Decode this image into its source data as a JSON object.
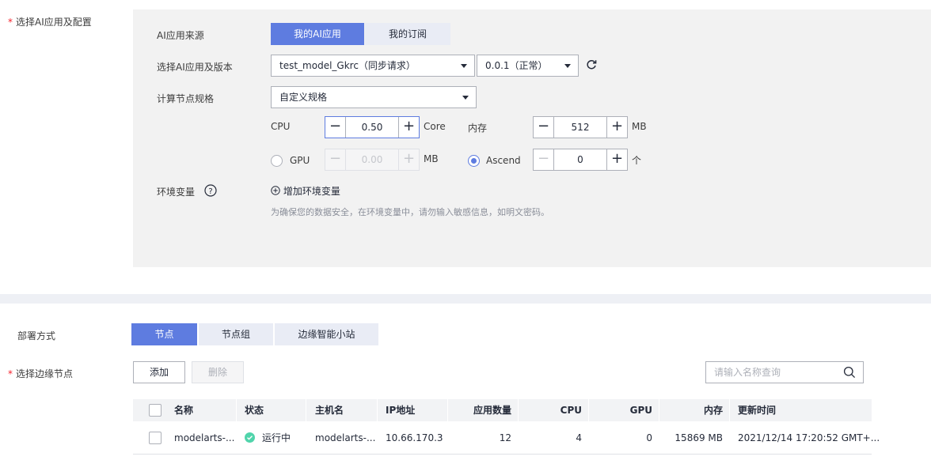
{
  "section_ai": {
    "label": "选择AI应用及配置",
    "source_label": "AI应用来源",
    "source_tabs": [
      "我的AI应用",
      "我的订阅"
    ],
    "app_version_label": "选择AI应用及版本",
    "app_select_value": "test_model_Gkrc（同步请求）",
    "version_select_value": "0.0.1（正常）",
    "compute_label": "计算节点规格",
    "compute_select_value": "自定义规格",
    "cpu": {
      "label": "CPU",
      "value": "0.50",
      "unit": "Core"
    },
    "memory": {
      "label": "内存",
      "value": "512",
      "unit": "MB"
    },
    "gpu": {
      "label": "GPU",
      "value": "0.00",
      "unit": "MB",
      "selected": false
    },
    "ascend": {
      "label": "Ascend",
      "value": "0",
      "unit": "个",
      "selected": true
    },
    "env_label": "环境变量",
    "env_add": "增加环境变量",
    "env_hint": "为确保您的数据安全，在环境变量中，请勿输入敏感信息，如明文密码。"
  },
  "deploy": {
    "label": "部署方式",
    "tabs": [
      "节点",
      "节点组",
      "边缘智能小站"
    ]
  },
  "edge_nodes": {
    "label": "选择边缘节点",
    "add_button": "添加",
    "delete_button": "删除",
    "search_placeholder": "请输入名称查询",
    "columns": [
      "名称",
      "状态",
      "主机名",
      "IP地址",
      "应用数量",
      "CPU",
      "GPU",
      "内存",
      "更新时间"
    ],
    "rows": [
      {
        "name": "modelarts-...",
        "status": "运行中",
        "hostname": "modelarts-...",
        "ip": "10.66.170.3",
        "apps": "12",
        "cpu": "4",
        "gpu": "0",
        "memory": "15869 MB",
        "updated": "2021/12/14 17:20:52 GMT+..."
      }
    ]
  },
  "colors": {
    "accent": "#5e7ce0",
    "success": "#50d4ab",
    "required": "#f5222d"
  }
}
